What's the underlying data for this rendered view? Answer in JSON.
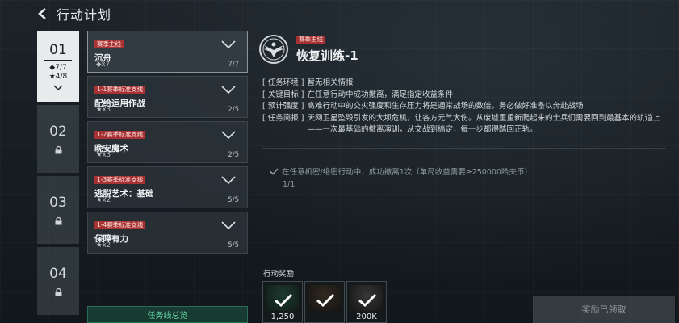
{
  "header": {
    "title": "行动计划",
    "back_icon": "back-arrow-icon"
  },
  "chapters": [
    {
      "num": "01",
      "diamond_stat": "◆7/7",
      "star_stat": "★4/8",
      "active": true
    },
    {
      "num": "02",
      "locked": true
    },
    {
      "num": "03",
      "locked": true
    },
    {
      "num": "04",
      "locked": true
    }
  ],
  "missions": [
    {
      "tag": "赛季主线",
      "name": "沉舟",
      "reward": "◆x7",
      "progress": "7/7",
      "active": true
    },
    {
      "tag": "1-1赛季标准支线",
      "name": "配给运用作战",
      "reward": "★x3",
      "progress": "2/5"
    },
    {
      "tag": "1-2赛季标准支线",
      "name": "晚安魔术",
      "reward": "★x3",
      "progress": "2/5"
    },
    {
      "tag": "1-3赛季标准支线",
      "name": "逃脱艺术：基础",
      "reward": "★x2",
      "progress": "5/5"
    },
    {
      "tag": "1-4赛季标准支线",
      "name": "保障有力",
      "reward": "★x2",
      "progress": "5/5"
    }
  ],
  "overview_button": "任务线总览",
  "detail": {
    "tag": "赛季主线",
    "title": "恢复训练-1",
    "info": [
      {
        "key": "[ 任务环境 ]",
        "value": "暂无相关情报"
      },
      {
        "key": "[ 关键目标 ]",
        "value": "在任意行动中成功撤离，满足指定收益条件"
      },
      {
        "key": "[ 预计强度 ]",
        "value": "高难行动中的交火强度和生存压力将是通常战场的数倍，务必做好准备以奔赴战场"
      },
      {
        "key": "[ 任务简报 ]",
        "value": "天网卫星坠毁引发的大坝危机，让各方元气大伤。从废墟里重新爬起来的士兵们需要回到最基本的轨道上——一次最基础的撤离演训，从交战到搞定，每一步都得踏回正轨。"
      }
    ],
    "objective": "在任意机密/绝密行动中，成功撤离1次（单局收益需要≥250000哈夫币）",
    "objective_progress": "1/1"
  },
  "rewards": {
    "label": "行动奖励",
    "items": [
      {
        "qty": "1,250",
        "icon": "currency-item-icon"
      },
      {
        "qty": "",
        "icon": "equipment-item-icon"
      },
      {
        "qty": "200K",
        "icon": "coin-item-icon"
      }
    ]
  },
  "claimed_button": "奖励已领取",
  "colors": {
    "tag_red": "#be3232",
    "overview_green": "#63d6a3",
    "active_tab": "#e8ebec"
  }
}
